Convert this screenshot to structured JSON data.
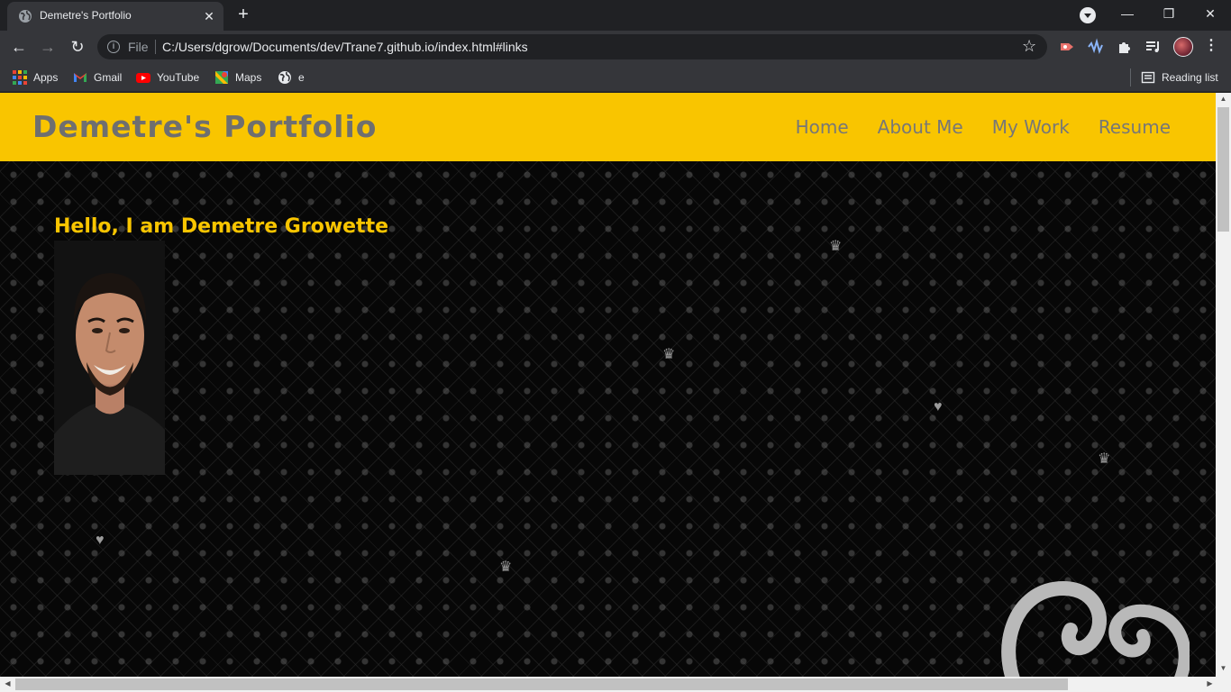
{
  "browser": {
    "tab": {
      "title": "Demetre's Portfolio"
    },
    "address": {
      "scheme": "File",
      "url": "C:/Users/dgrow/Documents/dev/Trane7.github.io/index.html#links"
    },
    "bookmarks": [
      {
        "label": "Apps",
        "icon": "apps-icon"
      },
      {
        "label": "Gmail",
        "icon": "gmail-icon"
      },
      {
        "label": "YouTube",
        "icon": "youtube-icon"
      },
      {
        "label": "Maps",
        "icon": "maps-icon"
      },
      {
        "label": "e",
        "icon": "globe-icon"
      }
    ],
    "reading_list": "Reading list"
  },
  "site": {
    "brand": "Demetre's Portfolio",
    "nav": [
      "Home",
      "About Me",
      "My Work",
      "Resume"
    ],
    "greeting": "Hello, I am Demetre Growette",
    "accent_color": "#f9c500"
  }
}
